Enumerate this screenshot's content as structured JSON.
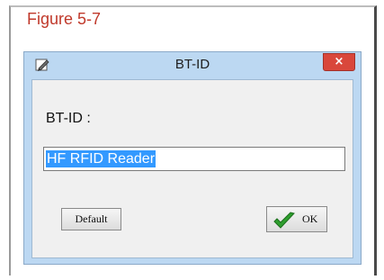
{
  "figure": {
    "label": "Figure 5-7"
  },
  "dialog": {
    "title": "BT-ID",
    "icon": "pen-icon",
    "close_glyph": "×",
    "field_label": "BT-ID :",
    "input_value": "HF RFID Reader",
    "default_label": "Default",
    "ok_label": "OK",
    "ok_icon": "green-check-icon"
  },
  "colors": {
    "figure_label": "#c0392b",
    "window_frame": "#bcd8f2",
    "close_button": "#d9473b",
    "selection": "#3399ff",
    "check": "#2e9e2e"
  }
}
